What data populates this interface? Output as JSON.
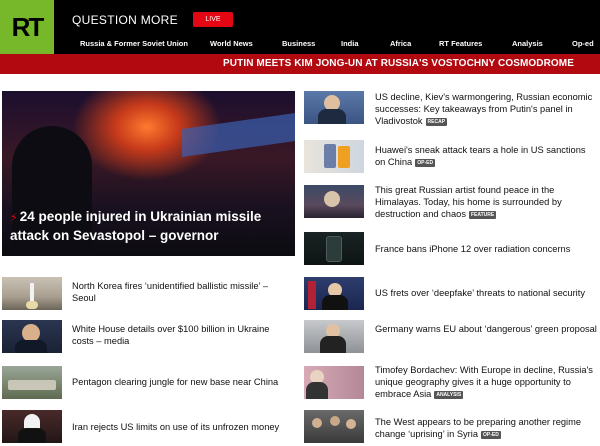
{
  "header": {
    "logo_text": "RT",
    "tagline": "QUESTION MORE",
    "live_label": "LIVE",
    "brand_color": "#77b82a",
    "live_color": "#e30613",
    "nav": [
      "Russia & Former Soviet Union",
      "World News",
      "Business",
      "India",
      "Africa",
      "RT Features",
      "Analysis",
      "Op-ed"
    ]
  },
  "banner": {
    "text": "PUTIN MEETS KIM JONG-UN AT RUSSIA'S VOSTOCHNY COSMODROME",
    "color": "#b1090f"
  },
  "hero": {
    "title": "24 people injured in Ukrainian missile attack on Sevastopol – governor",
    "icon": "lightning-bolt-icon"
  },
  "left_stories": [
    {
      "title": "North Korea fires ‘unidentified ballistic missile’ – Seoul"
    },
    {
      "title": "White House details over $100 billion in Ukraine costs – media"
    },
    {
      "title": "Pentagon clearing jungle for new base near China"
    },
    {
      "title": "Iran rejects US limits on use of its unfrozen money"
    }
  ],
  "right_stories": [
    {
      "title": "US decline, Kiev's warmongering, Russian economic successes: Key takeaways from Putin's panel in Vladivostok",
      "tag": "RECAP"
    },
    {
      "title": "Huawei's sneak attack tears a hole in US sanctions on China",
      "tag": "OP-ED"
    },
    {
      "title": "This great Russian artist found peace in the Himalayas. Today, his home is surrounded by destruction and chaos",
      "tag": "FEATURE"
    },
    {
      "title": "France bans iPhone 12 over radiation concerns",
      "tag": ""
    },
    {
      "title": "US frets over ‘deepfake’ threats to national security",
      "tag": ""
    },
    {
      "title": "Germany warns EU about ‘dangerous’ green proposal",
      "tag": ""
    },
    {
      "title": "Timofey Bordachev: With Europe in decline, Russia's unique geography gives it a huge opportunity to embrace Asia",
      "tag": "ANALYSIS"
    },
    {
      "title": "The West appears to be preparing another regime change ‘uprising’ in Syria",
      "tag": "OP-ED"
    }
  ]
}
